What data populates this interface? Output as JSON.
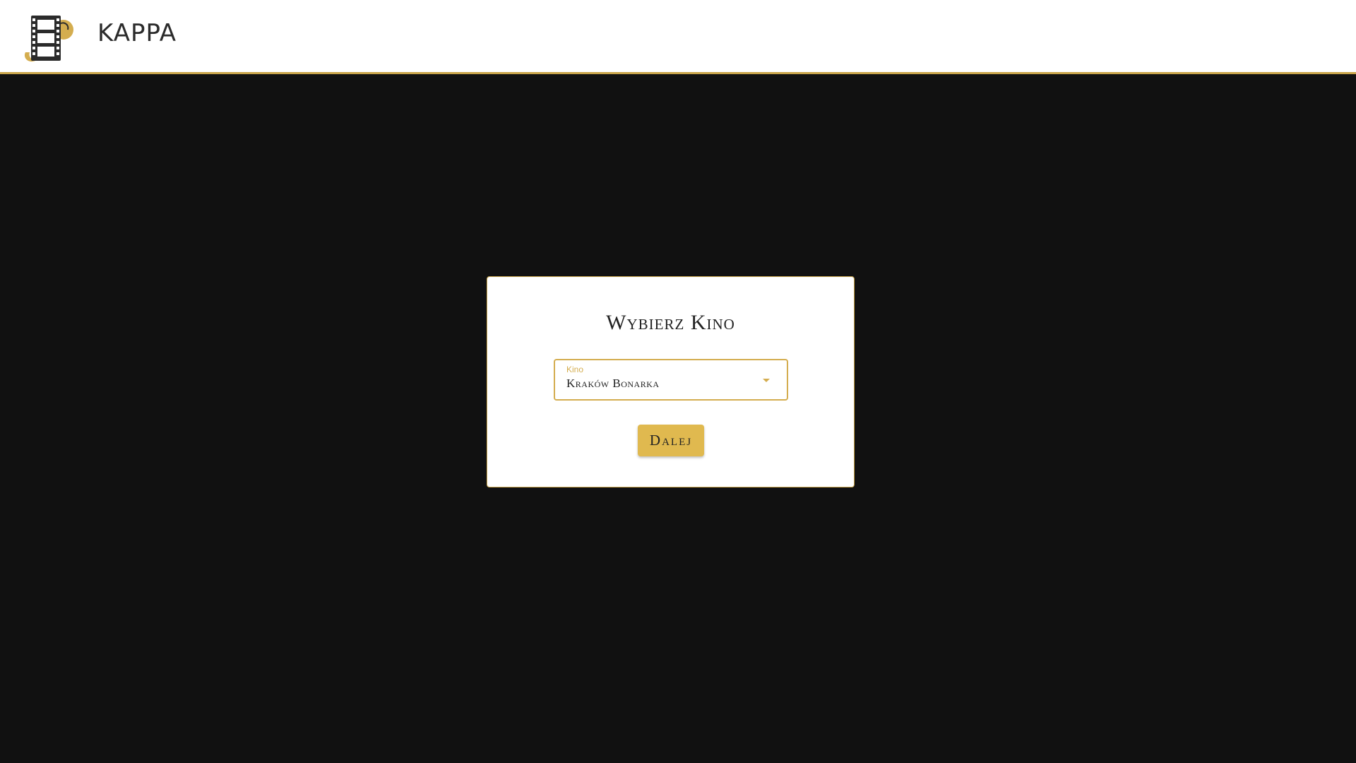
{
  "header": {
    "brand": "KAPPA",
    "logo_icon": "film-reel-logo-icon"
  },
  "colors": {
    "accent": "#d4ad4f",
    "background": "#111111",
    "header_bg": "#ffffff",
    "button_bg": "#e0b94f"
  },
  "dialog": {
    "title": "Wybierz Kino",
    "select": {
      "label": "Kino",
      "value": "Kraków Bonarka",
      "arrow_icon": "chevron-down-icon"
    },
    "next_button": "Dalej"
  }
}
